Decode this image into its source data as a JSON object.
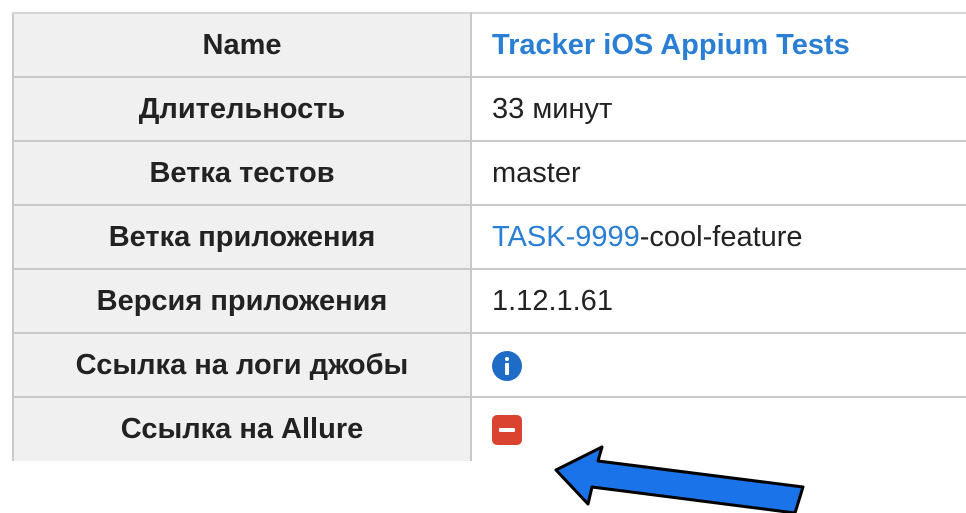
{
  "table": {
    "rows": [
      {
        "label": "Name",
        "value": "Tracker iOS Appium Tests"
      },
      {
        "label": "Длительность",
        "value": "33 минут"
      },
      {
        "label": "Ветка тестов",
        "value": "master"
      },
      {
        "label": "Ветка приложения",
        "value_link": "TASK-9999",
        "value_rest": "-cool-feature"
      },
      {
        "label": "Версия приложения",
        "value": "1.12.1.61"
      },
      {
        "label": "Ссылка на логи джобы",
        "icon": "info-icon"
      },
      {
        "label": "Ссылка на Allure",
        "icon": "minus-icon"
      }
    ]
  },
  "colors": {
    "link": "#2a7fd4",
    "info_icon": "#1f6cc7",
    "error_icon": "#d9432f",
    "arrow": "#1a73e8"
  }
}
